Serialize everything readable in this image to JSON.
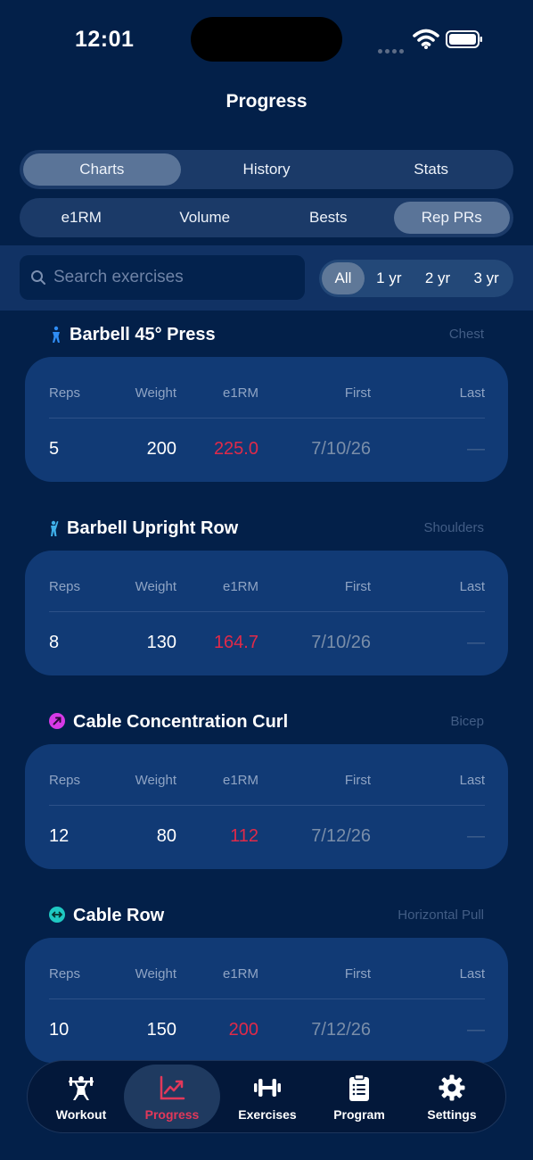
{
  "status_bar": {
    "time": "12:01"
  },
  "page_title": "Progress",
  "main_tabs": [
    "Charts",
    "History",
    "Stats"
  ],
  "main_tab_active": "Charts",
  "sub_tabs": [
    "e1RM",
    "Volume",
    "Bests",
    "Rep PRs"
  ],
  "sub_tab_active": "Rep PRs",
  "search": {
    "placeholder": "Search exercises",
    "value": ""
  },
  "range_filters": [
    "All",
    "1 yr",
    "2 yr",
    "3 yr"
  ],
  "range_active": "All",
  "columns": [
    "Reps",
    "Weight",
    "e1RM",
    "First",
    "Last"
  ],
  "exercises": [
    {
      "name": "Barbell 45° Press",
      "category": "Chest",
      "icon": "person-standing-icon",
      "icon_color": "#2f8df5",
      "row": {
        "reps": "5",
        "weight": "200",
        "e1rm": "225.0",
        "first": "7/10/26",
        "last": "—"
      }
    },
    {
      "name": "Barbell Upright Row",
      "category": "Shoulders",
      "icon": "person-arms-up-icon",
      "icon_color": "#3fb0ea",
      "row": {
        "reps": "8",
        "weight": "130",
        "e1rm": "164.7",
        "first": "7/10/26",
        "last": "—"
      }
    },
    {
      "name": "Cable Concentration Curl",
      "category": "Bicep",
      "icon": "curl-arrow-icon",
      "icon_color": "#d63ae6",
      "row": {
        "reps": "12",
        "weight": "80",
        "e1rm": "112",
        "first": "7/12/26",
        "last": "—"
      }
    },
    {
      "name": "Cable Row",
      "category": "Horizontal Pull",
      "icon": "horizontal-arrows-icon",
      "icon_color": "#1fc9c3",
      "row": {
        "reps": "10",
        "weight": "150",
        "e1rm": "200",
        "first": "7/12/26",
        "last": "—"
      }
    }
  ],
  "tab_bar": [
    {
      "label": "Workout",
      "icon": "weightlifter-icon"
    },
    {
      "label": "Progress",
      "icon": "trend-chart-icon"
    },
    {
      "label": "Exercises",
      "icon": "dumbbell-icon"
    },
    {
      "label": "Program",
      "icon": "clipboard-icon"
    },
    {
      "label": "Settings",
      "icon": "gear-icon"
    }
  ],
  "tab_bar_active": "Progress",
  "colors": {
    "background": "#032049",
    "card": "#113a75",
    "accent_red": "#e02a49"
  }
}
